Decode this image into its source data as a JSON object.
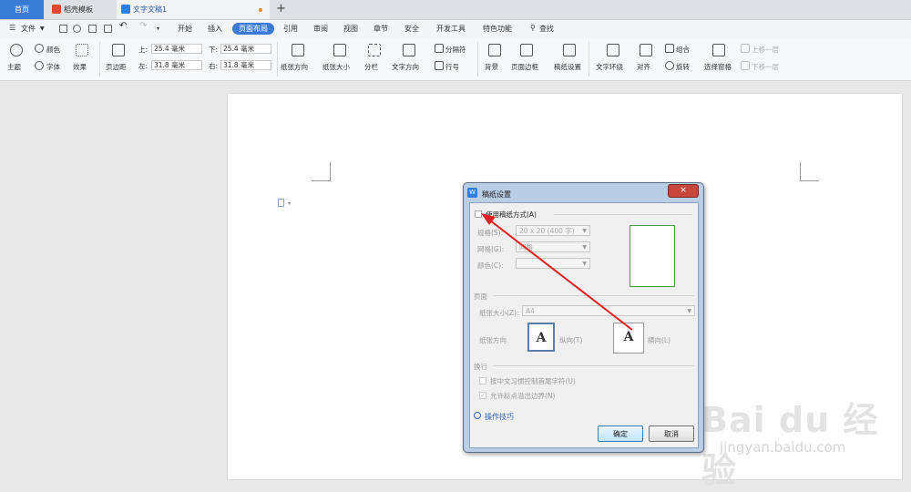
{
  "tabs": [
    {
      "label": "首页"
    },
    {
      "label": "稻壳模板"
    },
    {
      "label": "文字文稿1"
    }
  ],
  "menu": {
    "file": "文件",
    "items": [
      "开始",
      "插入",
      "页面布局",
      "引用",
      "审阅",
      "视图",
      "章节",
      "安全",
      "开发工具",
      "特色功能"
    ],
    "active": "页面布局",
    "search": "查找"
  },
  "ribbon": {
    "theme": "主题",
    "color": "颜色",
    "font": "字体",
    "effect": "效果",
    "margin": "页边距",
    "top_label": "上:",
    "top_value": "25.4 毫米",
    "bottom_label": "下:",
    "bottom_value": "25.4 毫米",
    "left_label": "左:",
    "left_value": "31.8 毫米",
    "right_label": "右:",
    "right_value": "31.8 毫米",
    "orientation": "纸张方向",
    "size": "纸张大小",
    "columns": "分栏",
    "text_direction": "文字方向",
    "breaks": "分隔符",
    "line_numbers": "行号",
    "background": "背景",
    "page_border": "页面边框",
    "manuscript": "稿纸设置",
    "wrap": "文字环绕",
    "align": "对齐",
    "group": "组合",
    "rotate": "旋转",
    "selection_pane": "选择窗格",
    "bring_forward": "上移一层",
    "send_backward": "下移一层"
  },
  "dialog": {
    "title": "稿纸设置",
    "close": "×",
    "use_manuscript": "使用稿纸方式(A)",
    "spec_label": "规格(S):",
    "spec_value": "20 x 20 (400 字)",
    "grid_label": "网格(G):",
    "grid_value": "网格",
    "color_label": "颜色(C):",
    "page_group": "页面",
    "paper_size_label": "纸张大小(Z):",
    "paper_size_value": "A4",
    "orientation_label": "纸张方向",
    "portrait": "纵向(T)",
    "landscape": "横向(L)",
    "wrap_group": "换行",
    "opt1": "按中文习惯控制首尾字符(U)",
    "opt2": "允许标点溢出边界(N)",
    "tips": "操作技巧",
    "ok": "确定",
    "cancel": "取消",
    "glyph": "A"
  },
  "watermark": {
    "brand": "Bai du 经验",
    "url": "jingyan.baidu.com"
  }
}
